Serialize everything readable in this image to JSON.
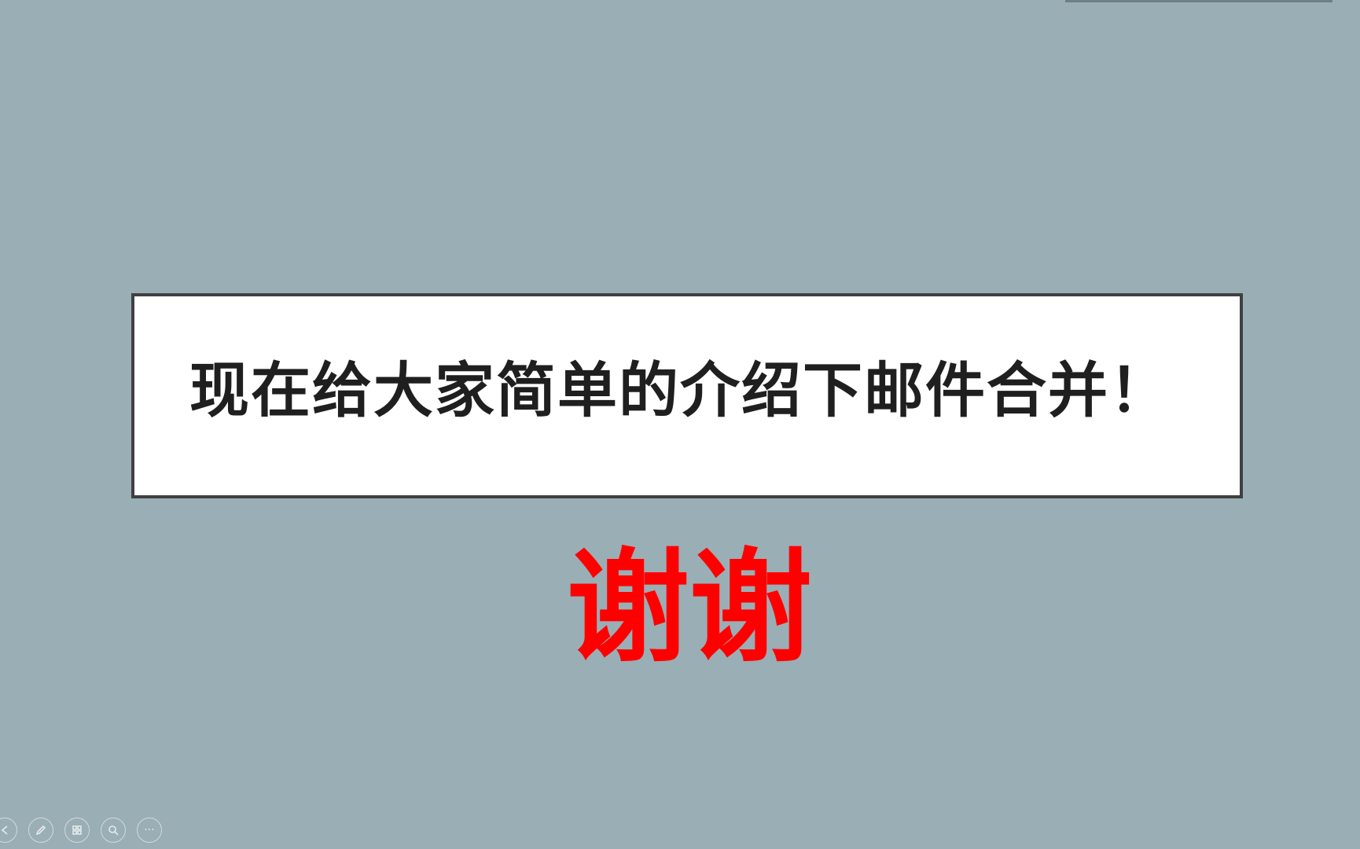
{
  "slide": {
    "intro_text": "现在给大家简单的介绍下邮件合并！",
    "thanks_text": "谢谢"
  },
  "colors": {
    "background": "#9aaeb5",
    "box_border": "#404040",
    "thanks": "#ff0000"
  },
  "toolbar": {
    "buttons": [
      {
        "icon": "arrow-icon"
      },
      {
        "icon": "pen-icon"
      },
      {
        "icon": "slides-grid-icon"
      },
      {
        "icon": "zoom-icon"
      },
      {
        "icon": "more-icon",
        "label": "···"
      }
    ]
  }
}
